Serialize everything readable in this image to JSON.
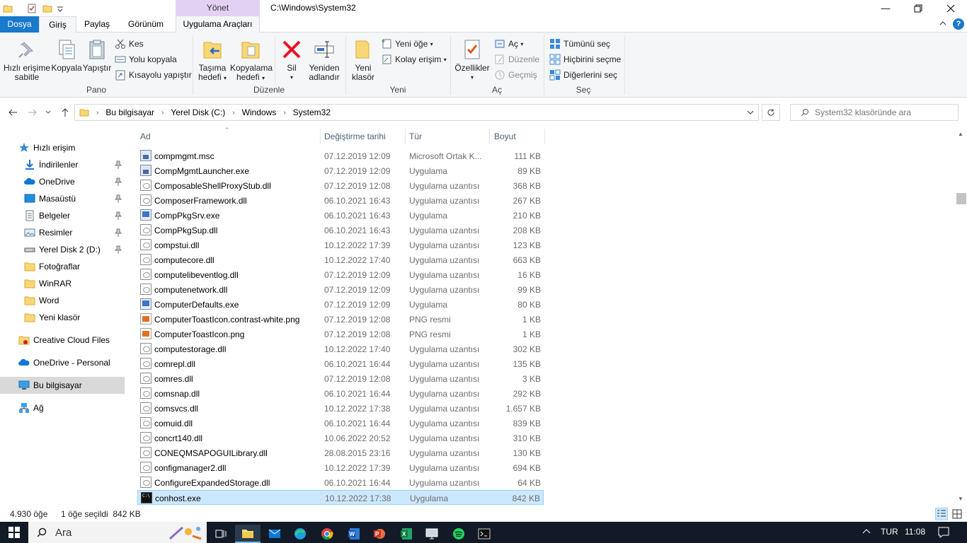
{
  "window": {
    "title": "C:\\Windows\\System32",
    "context_tab_group": "Yönet"
  },
  "tabs": {
    "file": "Dosya",
    "home": "Giriş",
    "share": "Paylaş",
    "view": "Görünüm",
    "app_tools": "Uygulama Araçları"
  },
  "ribbon": {
    "pano": {
      "label": "Pano",
      "pin": "Hızlı erişime sabitle",
      "pin_l1": "Hızlı erişime",
      "pin_l2": "sabitle",
      "copy": "Kopyala",
      "paste": "Yapıştır",
      "cut": "Kes",
      "copy_path": "Yolu kopyala",
      "paste_shortcut": "Kısayolu yapıştır"
    },
    "duzenle": {
      "label": "Düzenle",
      "move_l1": "Taşıma",
      "move_l2": "hedefi",
      "copyto_l1": "Kopyalama",
      "copyto_l2": "hedefi",
      "delete": "Sil",
      "rename_l1": "Yeniden",
      "rename_l2": "adlandır"
    },
    "yeni": {
      "label": "Yeni",
      "new_folder_l1": "Yeni",
      "new_folder_l2": "klasör",
      "new_item": "Yeni öğe",
      "easy_access": "Kolay erişim"
    },
    "ac": {
      "label": "Aç",
      "properties": "Özellikler",
      "open": "Aç",
      "edit": "Düzenle",
      "history": "Geçmiş"
    },
    "sec": {
      "label": "Seç",
      "select_all": "Tümünü seç",
      "select_none": "Hiçbirini seçme",
      "invert": "Diğerlerini seç"
    }
  },
  "address": {
    "crumbs": [
      "Bu bilgisayar",
      "Yerel Disk (C:)",
      "Windows",
      "System32"
    ],
    "search_placeholder": "System32 klasöründe ara"
  },
  "navpane": {
    "quick_access": "Hızlı erişim",
    "items": [
      {
        "label": "İndirilenler",
        "icon": "download-icon",
        "pinned": true
      },
      {
        "label": "OneDrive",
        "icon": "cloud-icon",
        "pinned": true
      },
      {
        "label": "Masaüstü",
        "icon": "desktop-icon",
        "pinned": true
      },
      {
        "label": "Belgeler",
        "icon": "documents-icon",
        "pinned": true
      },
      {
        "label": "Resimler",
        "icon": "pictures-icon",
        "pinned": true
      },
      {
        "label": "Yerel Disk 2 (D:)",
        "icon": "drive-icon",
        "pinned": true
      },
      {
        "label": "Fotoğraflar",
        "icon": "folder-icon",
        "pinned": false
      },
      {
        "label": "WinRAR",
        "icon": "folder-icon",
        "pinned": false
      },
      {
        "label": "Word",
        "icon": "folder-icon",
        "pinned": false
      },
      {
        "label": "Yeni klasör",
        "icon": "folder-icon",
        "pinned": false
      }
    ],
    "creative_cloud": "Creative Cloud Files",
    "onedrive_personal": "OneDrive - Personal",
    "this_pc": "Bu bilgisayar",
    "network": "Ağ"
  },
  "columns": {
    "name": "Ad",
    "date": "Değiştirme tarihi",
    "type": "Tür",
    "size": "Boyut"
  },
  "files": [
    {
      "name": "compmgmt.msc",
      "date": "07.12.2019 12:09",
      "type": "Microsoft Ortak K...",
      "size": "111 KB",
      "icon": "msc"
    },
    {
      "name": "CompMgmtLauncher.exe",
      "date": "07.12.2019 12:09",
      "type": "Uygulama",
      "size": "89 KB",
      "icon": "msc"
    },
    {
      "name": "ComposableShellProxyStub.dll",
      "date": "07.12.2019 12:08",
      "type": "Uygulama uzantısı",
      "size": "368 KB",
      "icon": "dll"
    },
    {
      "name": "ComposerFramework.dll",
      "date": "06.10.2021 16:43",
      "type": "Uygulama uzantısı",
      "size": "267 KB",
      "icon": "dll"
    },
    {
      "name": "CompPkgSrv.exe",
      "date": "06.10.2021 16:43",
      "type": "Uygulama",
      "size": "210 KB",
      "icon": "exe"
    },
    {
      "name": "CompPkgSup.dll",
      "date": "06.10.2021 16:43",
      "type": "Uygulama uzantısı",
      "size": "208 KB",
      "icon": "dll"
    },
    {
      "name": "compstui.dll",
      "date": "10.12.2022 17:39",
      "type": "Uygulama uzantısı",
      "size": "123 KB",
      "icon": "dll"
    },
    {
      "name": "computecore.dll",
      "date": "10.12.2022 17:40",
      "type": "Uygulama uzantısı",
      "size": "663 KB",
      "icon": "dll"
    },
    {
      "name": "computelibeventlog.dll",
      "date": "07.12.2019 12:09",
      "type": "Uygulama uzantısı",
      "size": "16 KB",
      "icon": "dll"
    },
    {
      "name": "computenetwork.dll",
      "date": "07.12.2019 12:09",
      "type": "Uygulama uzantısı",
      "size": "99 KB",
      "icon": "dll"
    },
    {
      "name": "ComputerDefaults.exe",
      "date": "07.12.2019 12:09",
      "type": "Uygulama",
      "size": "80 KB",
      "icon": "exe"
    },
    {
      "name": "ComputerToastIcon.contrast-white.png",
      "date": "07.12.2019 12:08",
      "type": "PNG resmi",
      "size": "1 KB",
      "icon": "png"
    },
    {
      "name": "ComputerToastIcon.png",
      "date": "07.12.2019 12:08",
      "type": "PNG resmi",
      "size": "1 KB",
      "icon": "png"
    },
    {
      "name": "computestorage.dll",
      "date": "10.12.2022 17:40",
      "type": "Uygulama uzantısı",
      "size": "302 KB",
      "icon": "dll"
    },
    {
      "name": "comrepl.dll",
      "date": "06.10.2021 16:44",
      "type": "Uygulama uzantısı",
      "size": "135 KB",
      "icon": "dll"
    },
    {
      "name": "comres.dll",
      "date": "07.12.2019 12:08",
      "type": "Uygulama uzantısı",
      "size": "3 KB",
      "icon": "dll"
    },
    {
      "name": "comsnap.dll",
      "date": "06.10.2021 16:44",
      "type": "Uygulama uzantısı",
      "size": "292 KB",
      "icon": "dll"
    },
    {
      "name": "comsvcs.dll",
      "date": "10.12.2022 17:38",
      "type": "Uygulama uzantısı",
      "size": "1.657 KB",
      "icon": "dll"
    },
    {
      "name": "comuid.dll",
      "date": "06.10.2021 16:44",
      "type": "Uygulama uzantısı",
      "size": "839 KB",
      "icon": "dll"
    },
    {
      "name": "concrt140.dll",
      "date": "10.06.2022 20:52",
      "type": "Uygulama uzantısı",
      "size": "310 KB",
      "icon": "dll"
    },
    {
      "name": "CONEQMSAPOGUILibrary.dll",
      "date": "28.08.2015 23:16",
      "type": "Uygulama uzantısı",
      "size": "130 KB",
      "icon": "dll"
    },
    {
      "name": "configmanager2.dll",
      "date": "10.12.2022 17:39",
      "type": "Uygulama uzantısı",
      "size": "694 KB",
      "icon": "dll"
    },
    {
      "name": "ConfigureExpandedStorage.dll",
      "date": "06.10.2021 16:44",
      "type": "Uygulama uzantısı",
      "size": "64 KB",
      "icon": "dll"
    },
    {
      "name": "conhost.exe",
      "date": "10.12.2022 17:38",
      "type": "Uygulama",
      "size": "842 KB",
      "icon": "con",
      "selected": true
    }
  ],
  "status": {
    "item_count": "4.930 öğe",
    "selected": "1 öğe seçildi  842 KB"
  },
  "taskbar": {
    "search_placeholder": "Ara",
    "language": "TUR",
    "time": "11:08"
  },
  "colors": {
    "file_tab": "#1979ca",
    "context_tab": "#e3d1f4",
    "selection": "#cce8ff",
    "taskbar": "#111a26"
  }
}
